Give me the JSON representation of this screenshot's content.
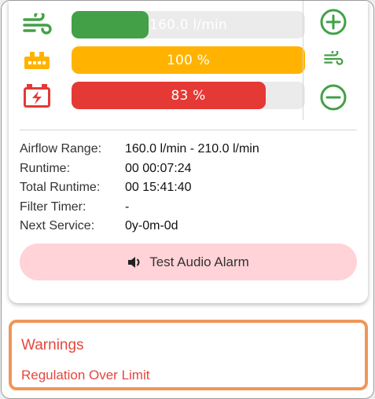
{
  "colors": {
    "airflow": "#43a047",
    "battery_level": "#ffb300",
    "battery": "#e53935",
    "controls": "#43a047",
    "warning_border": "#f0965a",
    "warning_text": "#e5473e",
    "alarm_button": "#ffd3d8"
  },
  "status": {
    "airflow": {
      "icon": "airflow-icon",
      "label": "160.0 l/min",
      "fraction": 0.33
    },
    "filter": {
      "icon": "filter-icon",
      "label": "100 %",
      "fraction": 1.0
    },
    "battery": {
      "icon": "battery-icon",
      "label": "83 %",
      "fraction": 0.83
    }
  },
  "controls": {
    "increase_icon": "plus-circle-icon",
    "mode_icon": "airflow-icon",
    "decrease_icon": "minus-circle-icon"
  },
  "info": [
    {
      "label": "Airflow Range:",
      "value": "160.0 l/min - 210.0 l/min"
    },
    {
      "label": "Runtime:",
      "value": "00 00:07:24"
    },
    {
      "label": "Total Runtime:",
      "value": "00 15:41:40"
    },
    {
      "label": "Filter Timer:",
      "value": "-"
    },
    {
      "label": "Next Service:",
      "value": "0y-0m-0d"
    }
  ],
  "alarm": {
    "label": "Test Audio Alarm",
    "icon": "speaker-icon"
  },
  "warnings": {
    "title": "Warnings",
    "items": [
      "Regulation Over Limit"
    ]
  }
}
